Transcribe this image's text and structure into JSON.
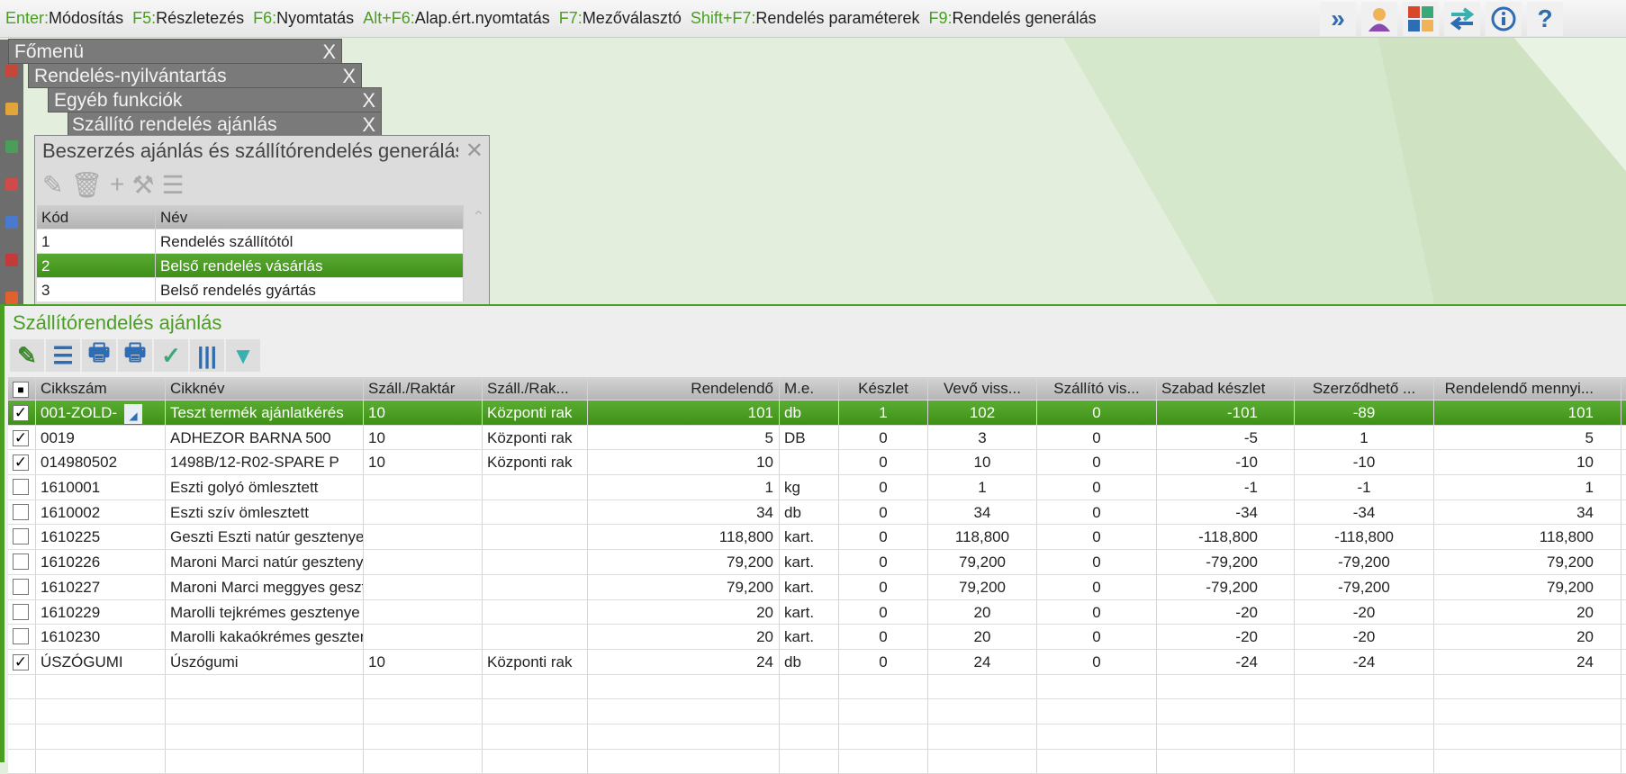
{
  "shortcuts": [
    {
      "key": "Enter:",
      "label": "Módosítás"
    },
    {
      "key": "F5:",
      "label": "Részletezés"
    },
    {
      "key": "F6:",
      "label": "Nyomtatás"
    },
    {
      "key": "Alt+F6:",
      "label": "Alap.ért.nyomtatás"
    },
    {
      "key": "F7:",
      "label": "Mezőválasztó"
    },
    {
      "key": "Shift+F7:",
      "label": "Rendelés paraméterek"
    },
    {
      "key": "F9:",
      "label": "Rendelés generálás"
    }
  ],
  "top_icons": [
    "double-chevron-right-icon",
    "user-icon",
    "tiles-icon",
    "swap-arrows-icon",
    "info-icon",
    "help-icon"
  ],
  "windows": [
    "Főmenü",
    "Rendelés-nyilvántartás",
    "Egyéb funkciók",
    "Szállító rendelés ajánlás"
  ],
  "close_glyph": "X",
  "dialog": {
    "title": "Beszerzés ajánlás és szállítórendelés generálás",
    "columns": [
      "Kód",
      "Név"
    ],
    "rows": [
      [
        "1",
        "Rendelés szállítótól"
      ],
      [
        "2",
        "Belső rendelés vásárlás"
      ],
      [
        "3",
        "Belső rendelés gyártás"
      ]
    ]
  },
  "panel": {
    "title": "Szállítórendelés ajánlás",
    "columns": [
      "Cikkszám",
      "Cikknév",
      "Száll./Raktár",
      "Száll./Rak...",
      "Rendelendő",
      "M.e.",
      "Készlet",
      "Vevő viss...",
      "Szállító vis...",
      "Szabad készlet",
      "Szerződhető ...",
      "Rendelendő mennyi..."
    ],
    "rows": [
      {
        "checked": true,
        "cells": [
          "001-ZOLD-",
          "Teszt termék ajánlatkérés",
          "10",
          "Központi rak",
          "101",
          "db",
          "1",
          "102",
          "0",
          "-101",
          "-89",
          "101"
        ]
      },
      {
        "checked": true,
        "cells": [
          "0019",
          "ADHEZOR BARNA 500",
          "10",
          "Központi rak",
          "5",
          "DB",
          "0",
          "3",
          "0",
          "-5",
          "1",
          "5"
        ]
      },
      {
        "checked": true,
        "cells": [
          "014980502",
          "1498B/12-R02-SPARE P",
          "10",
          "Központi rak",
          "10",
          "",
          "0",
          "10",
          "0",
          "-10",
          "-10",
          "10"
        ]
      },
      {
        "checked": false,
        "cells": [
          "1610001",
          "Eszti golyó ömlesztett",
          "",
          "",
          "1",
          "kg",
          "0",
          "1",
          "0",
          "-1",
          "-1",
          "1"
        ]
      },
      {
        "checked": false,
        "cells": [
          "1610002",
          "Eszti szív ömlesztett",
          "",
          "",
          "34",
          "db",
          "0",
          "34",
          "0",
          "-34",
          "-34",
          "34"
        ]
      },
      {
        "checked": false,
        "cells": [
          "1610225",
          "Geszti Eszti natúr gesztenye",
          "",
          "",
          "118,800",
          "kart.",
          "0",
          "118,800",
          "0",
          "-118,800",
          "-118,800",
          "118,800"
        ]
      },
      {
        "checked": false,
        "cells": [
          "1610226",
          "Maroni Marci natúr gesztenye",
          "",
          "",
          "79,200",
          "kart.",
          "0",
          "79,200",
          "0",
          "-79,200",
          "-79,200",
          "79,200"
        ]
      },
      {
        "checked": false,
        "cells": [
          "1610227",
          "Maroni Marci meggyes gesztenye",
          "",
          "",
          "79,200",
          "kart.",
          "0",
          "79,200",
          "0",
          "-79,200",
          "-79,200",
          "79,200"
        ]
      },
      {
        "checked": false,
        "cells": [
          "1610229",
          "Marolli tejkrémes gesztenye",
          "",
          "",
          "20",
          "kart.",
          "0",
          "20",
          "0",
          "-20",
          "-20",
          "20"
        ]
      },
      {
        "checked": false,
        "cells": [
          "1610230",
          "Marolli kakaókrémes gesztenye",
          "",
          "",
          "20",
          "kart.",
          "0",
          "20",
          "0",
          "-20",
          "-20",
          "20"
        ]
      },
      {
        "checked": true,
        "cells": [
          "ÚSZÓGUMI",
          "Úszógumi",
          "10",
          "Központi rak",
          "24",
          "db",
          "0",
          "24",
          "0",
          "-24",
          "-24",
          "24"
        ]
      }
    ]
  },
  "colors": {
    "accent": "#4a9e22",
    "background": "#e3eedd"
  }
}
